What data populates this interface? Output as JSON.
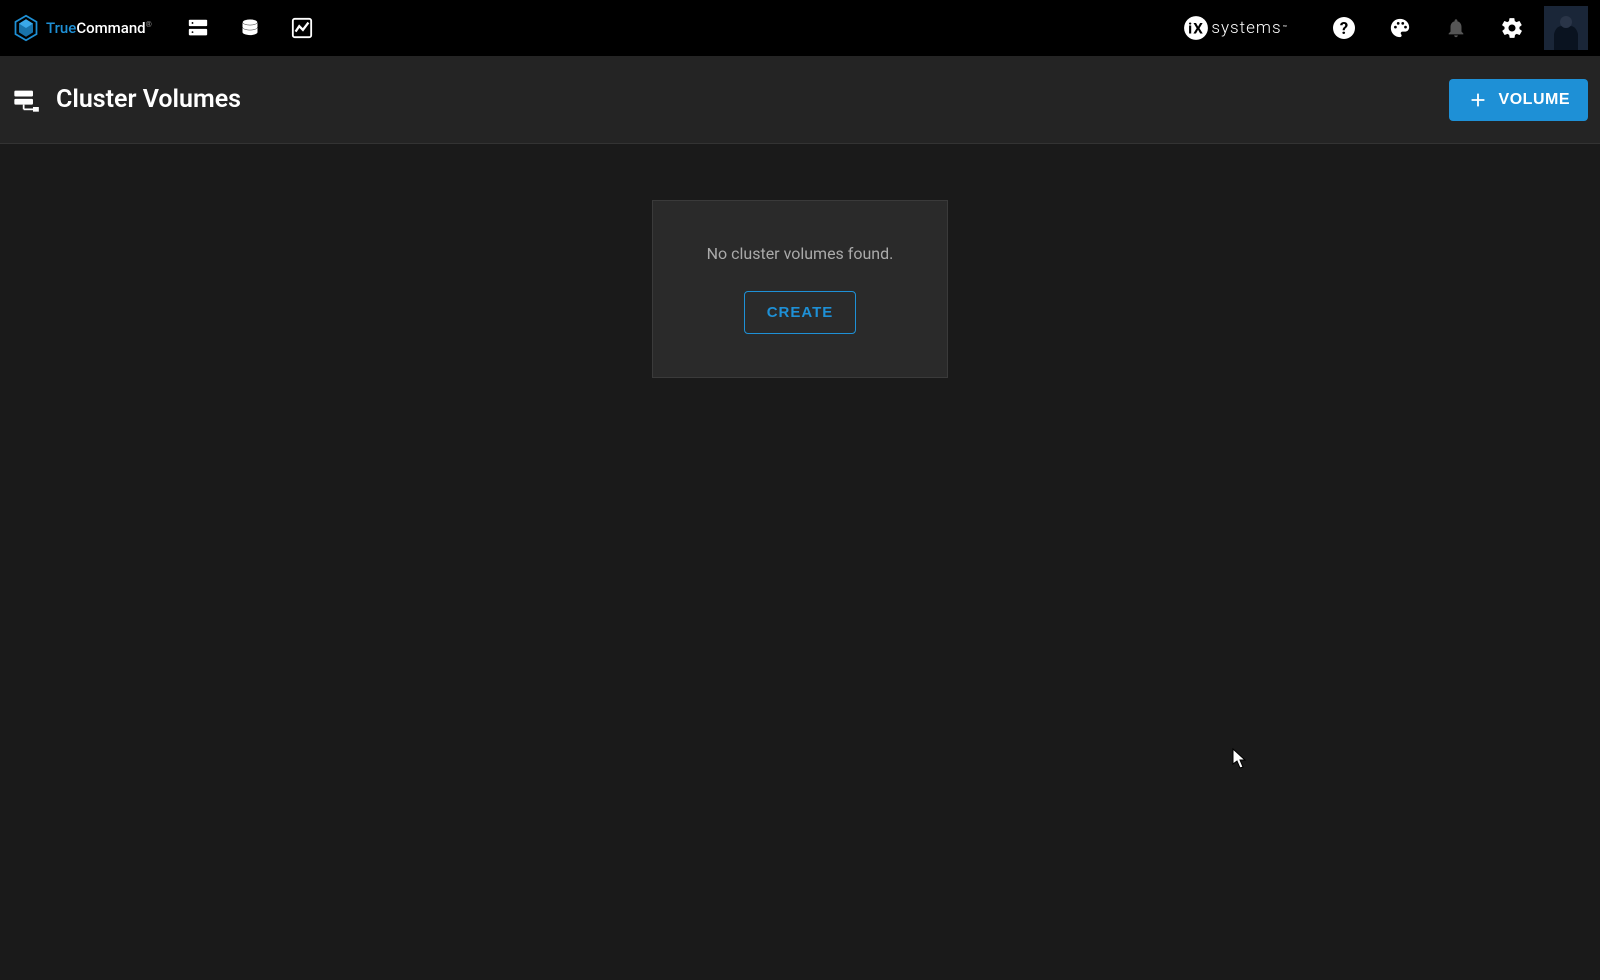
{
  "brand": {
    "name_true": "True",
    "name_command": "Command",
    "trademark": "®"
  },
  "ixsystems": {
    "label": "systems"
  },
  "header": {
    "page_title": "Cluster Volumes",
    "volume_button": "VOLUME"
  },
  "empty_state": {
    "message": "No cluster volumes found.",
    "create_button": "CREATE"
  }
}
